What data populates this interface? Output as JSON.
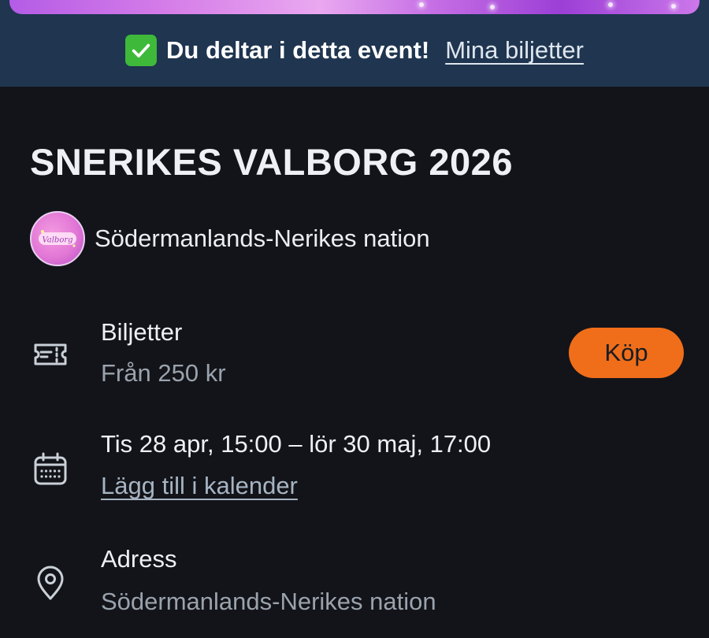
{
  "banner": {
    "participation_text": "Du deltar i detta event!",
    "tickets_link": "Mina biljetter",
    "check_color": "#3fb93a"
  },
  "event": {
    "title": "SNERIKES VALBORG 2026",
    "organizer": "Södermanlands-Nerikes nation",
    "organizer_avatar_text": "Valborg"
  },
  "tickets": {
    "label": "Biljetter",
    "price": "Från 250 kr",
    "buy_label": "Köp",
    "buy_color": "#f06e1a"
  },
  "date": {
    "range": "Tis 28 apr, 15:00 – lör 30 maj, 17:00",
    "calendar_link": "Lägg till i kalender"
  },
  "address": {
    "label": "Adress",
    "value": "Södermanlands-Nerikes nation"
  },
  "icons": {
    "ticket": "ticket-icon",
    "calendar": "calendar-icon",
    "location": "location-pin-icon",
    "check": "check-icon"
  }
}
